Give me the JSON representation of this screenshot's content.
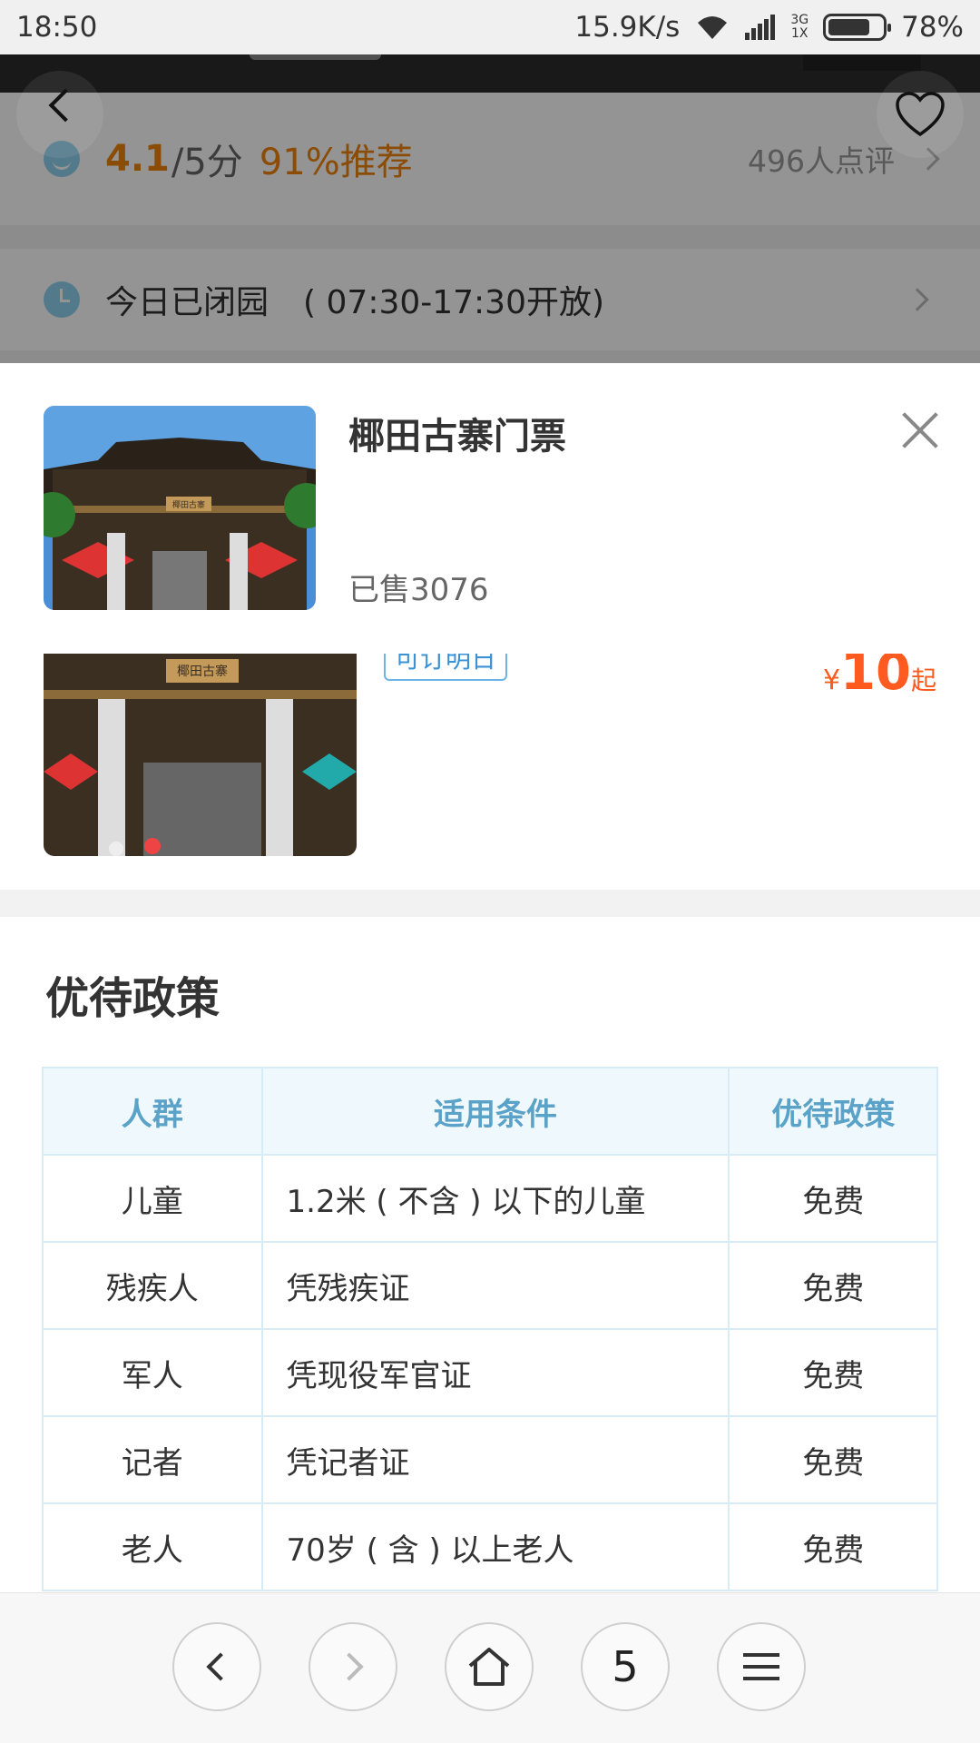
{
  "status_bar": {
    "time": "18:50",
    "speed": "15.9K/s",
    "network_top": "3G",
    "network_bottom": "1X",
    "battery": "78%",
    "battery_level": 0.78
  },
  "rating": {
    "score": "4.1",
    "score_total": "/5分",
    "recommend": "91%推荐",
    "review_count": "496人点评"
  },
  "hours": {
    "status": "今日已闭园",
    "range": "( 07:30-17:30开放)"
  },
  "popup": {
    "title": "椰田古寨门票",
    "sold": "已售3076",
    "sign_text": "椰田古寨"
  },
  "ticket": {
    "tag": "可订明日",
    "currency": "¥",
    "price": "10",
    "unit": "起",
    "sign_text": "椰田古寨"
  },
  "policy": {
    "heading": "优待政策",
    "columns": [
      "人群",
      "适用条件",
      "优待政策"
    ],
    "rows": [
      {
        "group": "儿童",
        "condition": "1.2米 ( 不含 ) 以下的儿童",
        "policy": "免费"
      },
      {
        "group": "残疾人",
        "condition": "凭残疾证",
        "policy": "免费"
      },
      {
        "group": "军人",
        "condition": "凭现役军官证",
        "policy": "免费"
      },
      {
        "group": "记者",
        "condition": "凭记者证",
        "policy": "免费"
      },
      {
        "group": "老人",
        "condition": "70岁 ( 含 ) 以上老人",
        "policy": "免费"
      }
    ]
  },
  "toolbar": {
    "tabs_count": "5"
  },
  "colors": {
    "accent_orange": "#f0830a",
    "price_red": "#ff5a1f",
    "table_header_text": "#5aa2c8",
    "tag_blue": "#3a92d6"
  }
}
